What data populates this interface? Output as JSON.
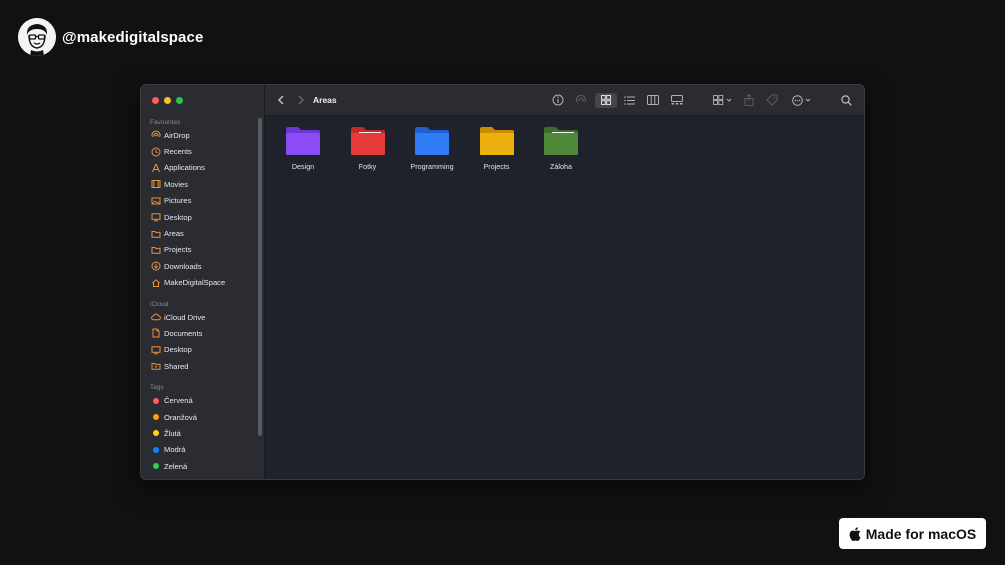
{
  "brand": {
    "handle": "@makedigitalspace"
  },
  "window": {
    "title": "Areas"
  },
  "sidebar": {
    "favourites_label": "Favourites",
    "favourites": [
      {
        "label": "AirDrop",
        "icon": "airdrop-icon"
      },
      {
        "label": "Recents",
        "icon": "clock-icon"
      },
      {
        "label": "Applications",
        "icon": "applications-icon"
      },
      {
        "label": "Movies",
        "icon": "film-icon"
      },
      {
        "label": "Pictures",
        "icon": "photo-icon"
      },
      {
        "label": "Desktop",
        "icon": "desktop-icon"
      },
      {
        "label": "Areas",
        "icon": "folder-icon"
      },
      {
        "label": "Projects",
        "icon": "folder-icon"
      },
      {
        "label": "Downloads",
        "icon": "download-icon"
      },
      {
        "label": "MakeDigitalSpace",
        "icon": "home-icon"
      }
    ],
    "icloud_label": "iCloud",
    "icloud": [
      {
        "label": "iCloud Drive",
        "icon": "cloud-icon"
      },
      {
        "label": "Documents",
        "icon": "document-icon"
      },
      {
        "label": "Desktop",
        "icon": "desktop-icon"
      },
      {
        "label": "Shared",
        "icon": "shared-folder-icon"
      }
    ],
    "tags_label": "Tags",
    "tags": [
      {
        "label": "Červená",
        "color": "#ff5f57"
      },
      {
        "label": "Oranžová",
        "color": "#ff9f0a"
      },
      {
        "label": "Žlutá",
        "color": "#ffd60a"
      },
      {
        "label": "Modrá",
        "color": "#0a84ff"
      },
      {
        "label": "Zelená",
        "color": "#30d158"
      }
    ]
  },
  "folders": [
    {
      "label": "Design",
      "color": "#8b4cf6",
      "dark": "#6d35d6"
    },
    {
      "label": "Fotky",
      "color": "#e63b3b",
      "dark": "#c22a2a"
    },
    {
      "label": "Programming",
      "color": "#2f7cf6",
      "dark": "#1f5fd0"
    },
    {
      "label": "Projects",
      "color": "#ecb10f",
      "dark": "#c98e06"
    },
    {
      "label": "Záloha",
      "color": "#4f8a3a",
      "dark": "#3d6d2c"
    }
  ],
  "badge": {
    "label": "Made for macOS"
  },
  "colors": {
    "accent_icon": "#e8913a",
    "background": "#111111"
  }
}
